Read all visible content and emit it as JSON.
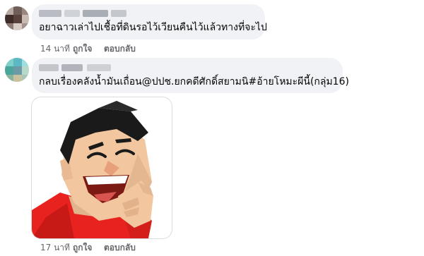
{
  "comments": [
    {
      "author": "",
      "text": "อยาฉาวเล่าไปเชื้อที่ดินรอไว้เวียนคืนไว้แล้วทางที่จะไป",
      "time": "14 นาที",
      "like_label": "ถูกใจ",
      "reply_label": "ตอบกลับ"
    },
    {
      "author": "",
      "text": "กลบเรื่องคลังน้ำมันเถื่อน@ปปช.ยกคดีศักดิ์สยามนิ#อ้ายโหมะผีนี้(กลุ่ม16)",
      "time": "17 นาที",
      "like_label": "ถูกใจ",
      "reply_label": "ตอบกลับ",
      "attachment": "laughing-man-sticker"
    }
  ],
  "colors": {
    "bubble": "#f0f2f5",
    "meta": "#65676b",
    "sticker_shirt": "#e8231f",
    "sticker_skin": "#f2c7a0",
    "sticker_hair": "#1a1a1a"
  }
}
